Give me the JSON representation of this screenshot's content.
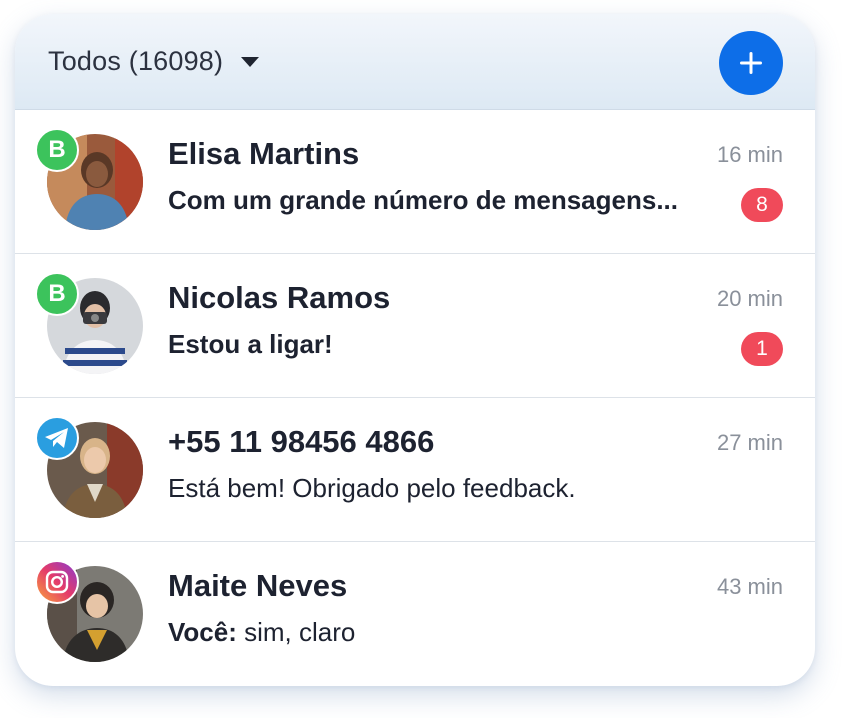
{
  "header": {
    "filter_label": "Todos (16098)",
    "add_button_icon": "plus-icon",
    "accent_color": "#0d6ee8"
  },
  "conversations": [
    {
      "name": "Elisa Martins",
      "time": "16 min",
      "message": "Com um grande número de mensagens...",
      "unread": "8",
      "channel": "whatsapp-business-icon",
      "channel_letter": "B"
    },
    {
      "name": "Nicolas Ramos",
      "time": "20 min",
      "message": "Estou a ligar!",
      "unread": "1",
      "channel": "whatsapp-business-icon",
      "channel_letter": "B"
    },
    {
      "name": "+55 11 98456 4866",
      "time": "27 min",
      "message": "Está bem! Obrigado pelo feedback.",
      "channel": "telegram-icon"
    },
    {
      "name": "Maite Neves",
      "time": "43 min",
      "message_prefix": "Você:",
      "message": " sim, claro",
      "channel": "instagram-icon"
    }
  ],
  "colors": {
    "unread_badge": "#f04a5a",
    "whatsapp": "#3cc35c",
    "telegram": "#2a9ee0"
  }
}
